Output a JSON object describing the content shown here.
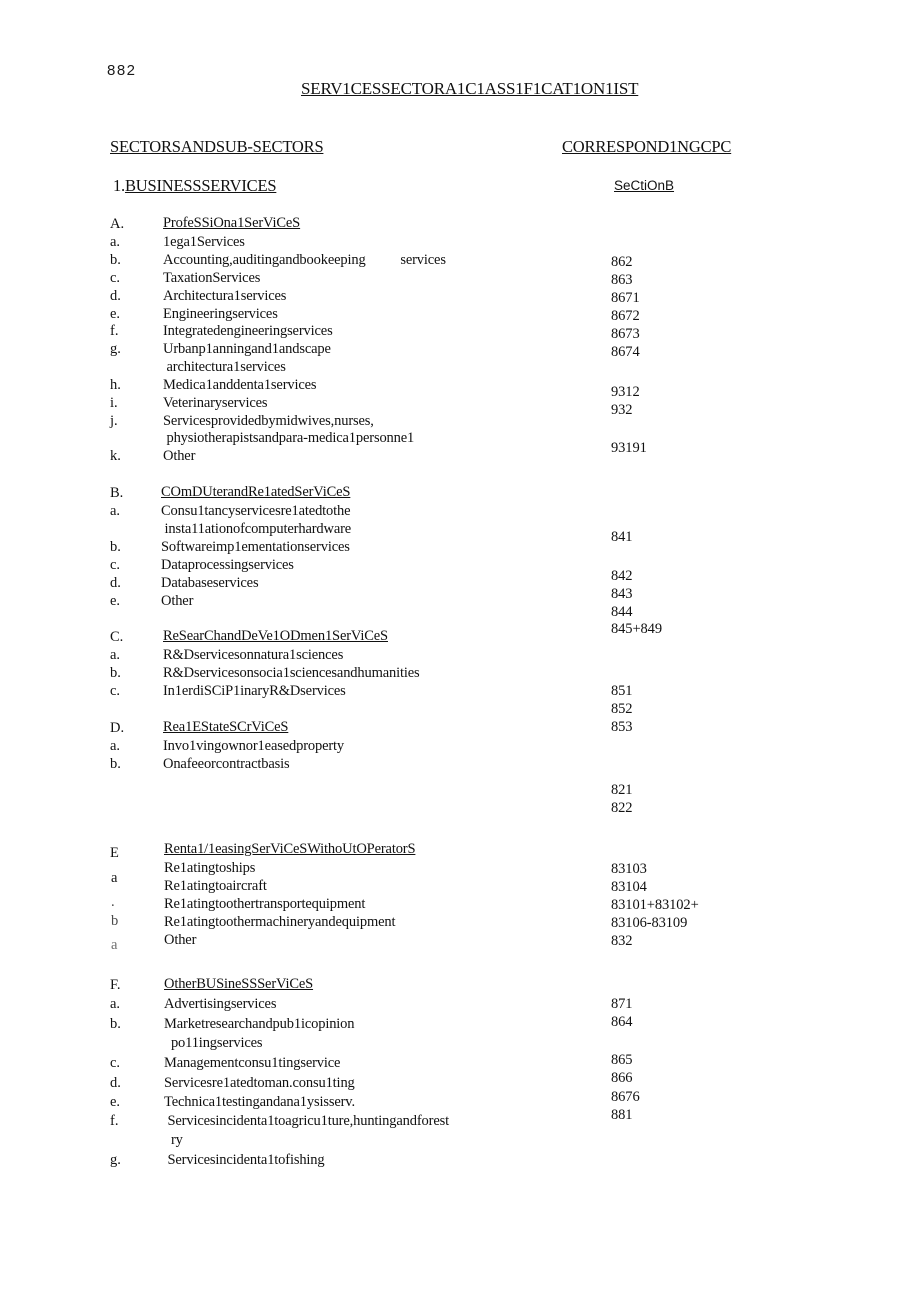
{
  "page": {
    "number": "882",
    "title": "SERV1CESSECTORA1C1ASS1F1CAT1ON1IST"
  },
  "headers": {
    "left": "SECTORSANDSUB-SECTORS",
    "right": "CORRESPOND1NGCPC"
  },
  "section_heading": {
    "number": "1.",
    "label": "BUSINESSSERVICES",
    "tag": "SeCtiOnB"
  },
  "groups": [
    {
      "letter": "A.",
      "title": "ProfeSSiOna1SerViCeS",
      "items": [
        {
          "marker": "a.",
          "text": "1ega1Services",
          "cpc": ""
        },
        {
          "marker": "b.",
          "text": "Accounting,auditingandbookeeping          services",
          "cpc": "862"
        },
        {
          "marker": "c.",
          "text": "TaxationServices",
          "cpc": "863"
        },
        {
          "marker": "d.",
          "text": "Architectura1services",
          "cpc": "8671"
        },
        {
          "marker": "e.",
          "text": "Engineeringservices",
          "cpc": "8672"
        },
        {
          "marker": "f.",
          "text": "Integratedengineeringservices",
          "cpc": "8673"
        },
        {
          "marker": "g.",
          "text": "Urbanp1anningand1andscape",
          "cpc": "8674"
        },
        {
          "marker": "",
          "text": " architectura1services",
          "cpc": ""
        },
        {
          "marker": "h.",
          "text": "Medica1anddenta1services",
          "cpc": ""
        },
        {
          "marker": "i.",
          "text": "Veterinaryservices",
          "cpc": "9312"
        },
        {
          "marker": "j.",
          "text": "Servicesprovidedbymidwives,nurses,",
          "cpc": "932"
        },
        {
          "marker": "",
          "text": " physiotherapistsandpara-medica1personne1",
          "cpc": ""
        },
        {
          "marker": "k.",
          "text": "Other",
          "cpc": "93191"
        }
      ]
    },
    {
      "letter": "B.",
      "title": "COmDUterandRe1atedSerViCeS",
      "items": [
        {
          "marker": "a.",
          "text": "Consu1tancyservicesre1atedtothe",
          "cpc": ""
        },
        {
          "marker": "",
          "text": " insta11ationofcomputerhardware",
          "cpc": ""
        },
        {
          "marker": "b.",
          "text": "Softwareimp1ementationservices",
          "cpc": "841"
        },
        {
          "marker": "c.",
          "text": "Dataprocessingservices",
          "cpc": ""
        },
        {
          "marker": "d.",
          "text": "Databaseservices",
          "cpc": "842"
        },
        {
          "marker": "e.",
          "text": "Other",
          "cpc": "843"
        }
      ]
    },
    {
      "letter": "C.",
      "title": "ReSearChandDeVe1ODmen1SerViCeS",
      "items": [
        {
          "marker": "a.",
          "text": "R&Dservicesonnatura1sciences",
          "cpc": ""
        },
        {
          "marker": "b.",
          "text": "R&Dservicesonsocia1sciencesandhumanities",
          "cpc": ""
        },
        {
          "marker": "c.",
          "text": "In1erdiSCiP1inaryR&Dservices",
          "cpc": ""
        }
      ]
    },
    {
      "letter": "D.",
      "title": "Rea1EStateSCrViCeS",
      "items": [
        {
          "marker": "a.",
          "text": "Invo1vingownor1easedproperty",
          "cpc": ""
        },
        {
          "marker": "b.",
          "text": "Onafeeorcontractbasis",
          "cpc": ""
        }
      ]
    },
    {
      "letter": "E",
      "title": "Renta1/1easingSerViCeSWithoUtOPeratorS",
      "items": [
        {
          "marker": "a",
          "text": "Re1atingtoships",
          "cpc": "83103"
        },
        {
          "marker": ".",
          "text": "Re1atingtoaircraft",
          "cpc": "83104"
        },
        {
          "marker": "b",
          "text": "Re1atingtoothertransportequipment",
          "cpc": "83101+83102+"
        },
        {
          "marker": "a",
          "text": "Re1atingtoothermachineryandequipment",
          "cpc": "83106-83109"
        },
        {
          "marker": "",
          "text": "Other",
          "cpc": "832"
        }
      ]
    },
    {
      "letter": "F.",
      "title": "OtherBUSineSSSerViCeS",
      "items": [
        {
          "marker": "a.",
          "text": "Advertisingservices",
          "cpc": "871"
        },
        {
          "marker": "b.",
          "text": "Marketresearchandpub1icopinion",
          "cpc": "864"
        },
        {
          "marker": "",
          "text": "  po11ingservices",
          "cpc": ""
        },
        {
          "marker": "c.",
          "text": "Managementconsu1tingservice",
          "cpc": "865"
        },
        {
          "marker": "d.",
          "text": "Servicesre1atedtoman.consu1ting",
          "cpc": "866"
        },
        {
          "marker": "e.",
          "text": "Technica1testingandana1ysisserv.",
          "cpc": "8676"
        },
        {
          "marker": "f.",
          "text": " Servicesincidenta1toagricu1ture,huntingandforest",
          "cpc": "881"
        },
        {
          "marker": "",
          "text": "  ry",
          "cpc": ""
        },
        {
          "marker": "g.",
          "text": " Servicesincidenta1tofishing",
          "cpc": ""
        }
      ]
    }
  ],
  "floating_cpc": {
    "d_group_821": "821",
    "d_group_822": "822",
    "b_group_844": "844",
    "b_group_845": "845+849",
    "c_group_851": "851",
    "c_group_852": "852",
    "c_group_853": "853"
  }
}
